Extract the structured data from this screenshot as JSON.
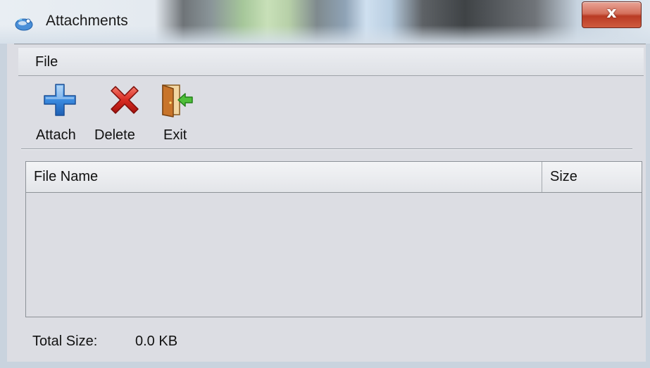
{
  "window": {
    "title": "Attachments",
    "close_glyph": "x",
    "title_icon": "attachments-globe-icon"
  },
  "menu": {
    "items": [
      {
        "label": "File"
      }
    ]
  },
  "toolbar": {
    "buttons": [
      {
        "label": "Attach",
        "icon": "add-icon",
        "color": "#2f7fd6"
      },
      {
        "label": "Delete",
        "icon": "delete-icon",
        "color": "#d42222"
      },
      {
        "label": "Exit",
        "icon": "exit-door-icon",
        "color": "#c8742a"
      }
    ]
  },
  "table": {
    "columns": [
      "File Name",
      "Size"
    ],
    "rows": []
  },
  "status": {
    "label": "Total Size:",
    "value": "0.0 KB"
  }
}
